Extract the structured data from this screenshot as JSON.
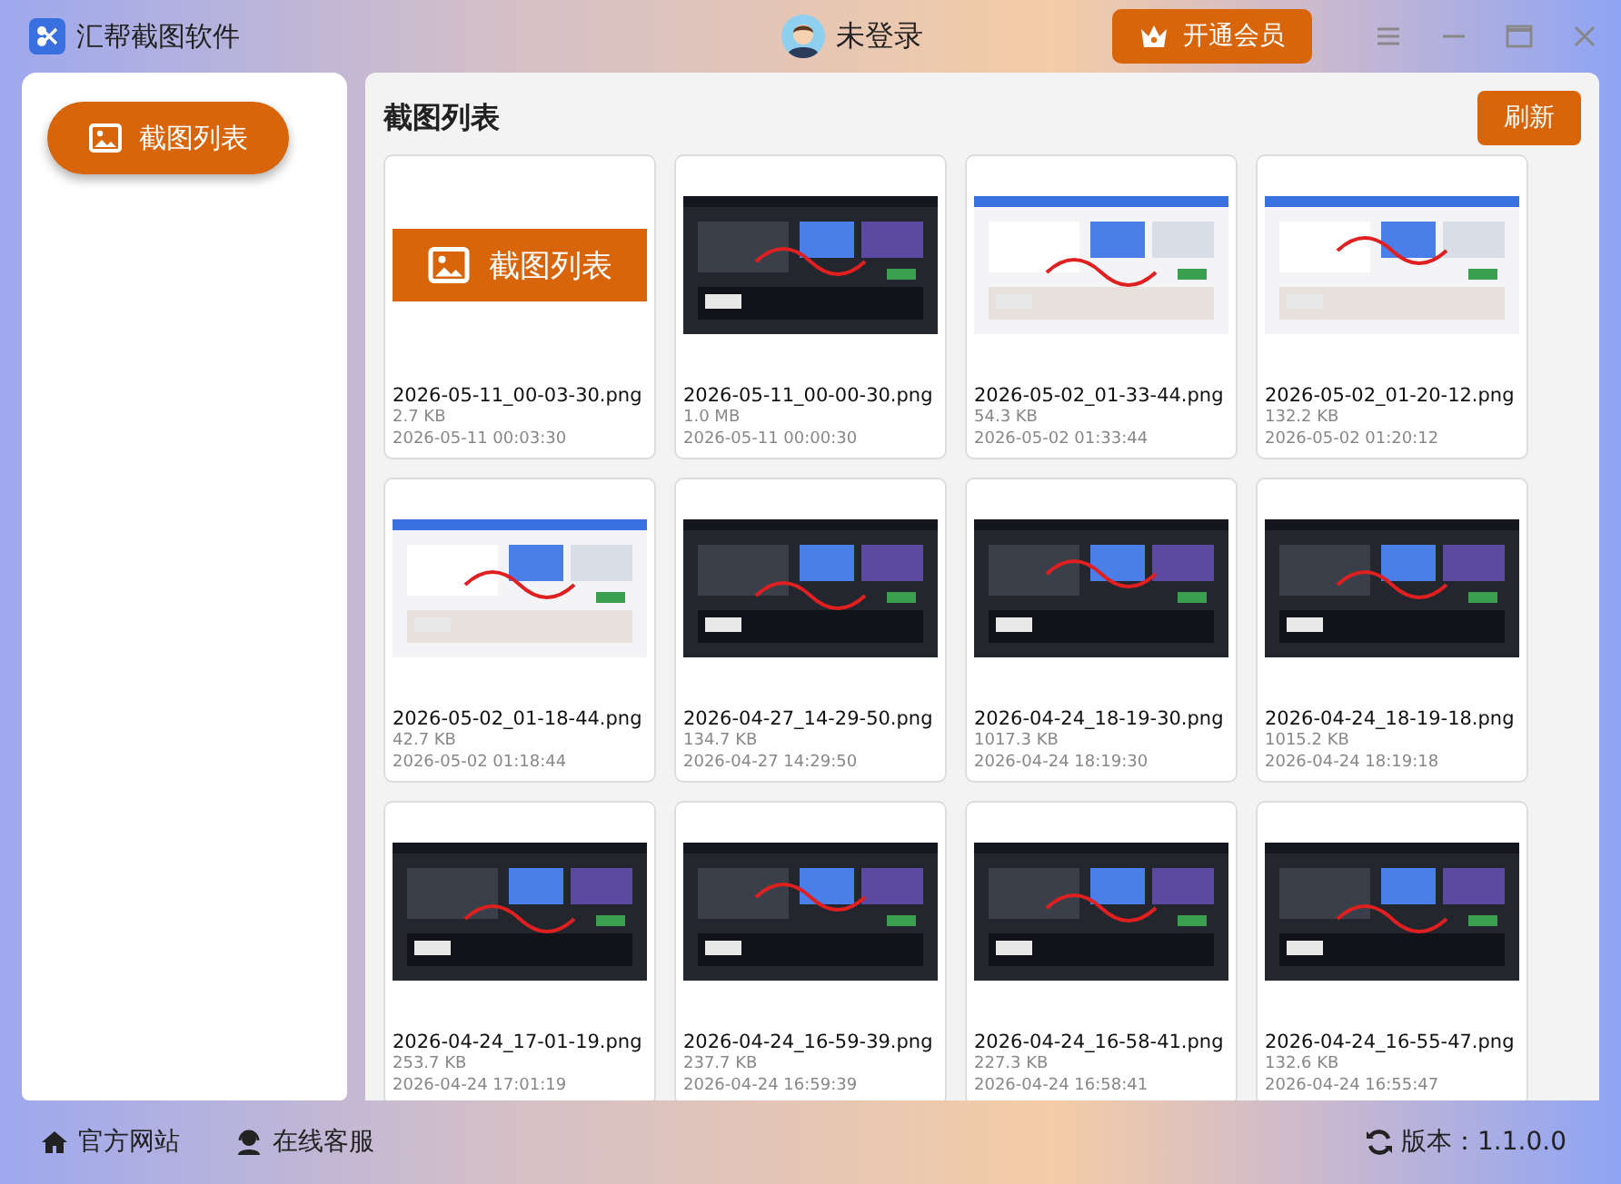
{
  "window": {
    "title": "汇帮截图软件"
  },
  "user": {
    "name": "未登录"
  },
  "vip_button": "开通会员",
  "sidebar": {
    "items": [
      {
        "label": "截图列表",
        "selected": true
      }
    ]
  },
  "main": {
    "title": "截图列表",
    "refresh_button": "刷新",
    "cards": [
      {
        "kind": "banner",
        "thumb_text": "截图列表",
        "name": "2026-05-11_00-03-30.png",
        "size": "2.7 KB",
        "time": "2026-05-11 00:03:30"
      },
      {
        "kind": "picture",
        "name": "2026-05-11_00-00-30.png",
        "size": "1.0 MB",
        "time": "2026-05-11 00:00:30"
      },
      {
        "kind": "picture",
        "name": "2026-05-02_01-33-44.png",
        "size": "54.3 KB",
        "time": "2026-05-02 01:33:44"
      },
      {
        "kind": "picture",
        "name": "2026-05-02_01-20-12.png",
        "size": "132.2 KB",
        "time": "2026-05-02 01:20:12"
      },
      {
        "kind": "picture",
        "name": "2026-05-02_01-18-44.png",
        "size": "42.7 KB",
        "time": "2026-05-02 01:18:44"
      },
      {
        "kind": "picture",
        "name": "2026-04-27_14-29-50.png",
        "size": "134.7 KB",
        "time": "2026-04-27 14:29:50"
      },
      {
        "kind": "picture",
        "name": "2026-04-24_18-19-30.png",
        "size": "1017.3 KB",
        "time": "2026-04-24 18:19:30"
      },
      {
        "kind": "picture",
        "name": "2026-04-24_18-19-18.png",
        "size": "1015.2 KB",
        "time": "2026-04-24 18:19:18"
      },
      {
        "kind": "picture",
        "name": "2026-04-24_17-01-19.png",
        "size": "253.7 KB",
        "time": "2026-04-24 17:01:19"
      },
      {
        "kind": "picture",
        "name": "2026-04-24_16-59-39.png",
        "size": "237.7 KB",
        "time": "2026-04-24 16:59:39"
      },
      {
        "kind": "picture",
        "name": "2026-04-24_16-58-41.png",
        "size": "227.3 KB",
        "time": "2026-04-24 16:58:41"
      },
      {
        "kind": "picture",
        "name": "2026-04-24_16-55-47.png",
        "size": "132.6 KB",
        "time": "2026-04-24 16:55:47"
      }
    ]
  },
  "footer": {
    "website_link": "官方网站",
    "support_link": "在线客服",
    "version": "版本：1.1.0.0"
  }
}
